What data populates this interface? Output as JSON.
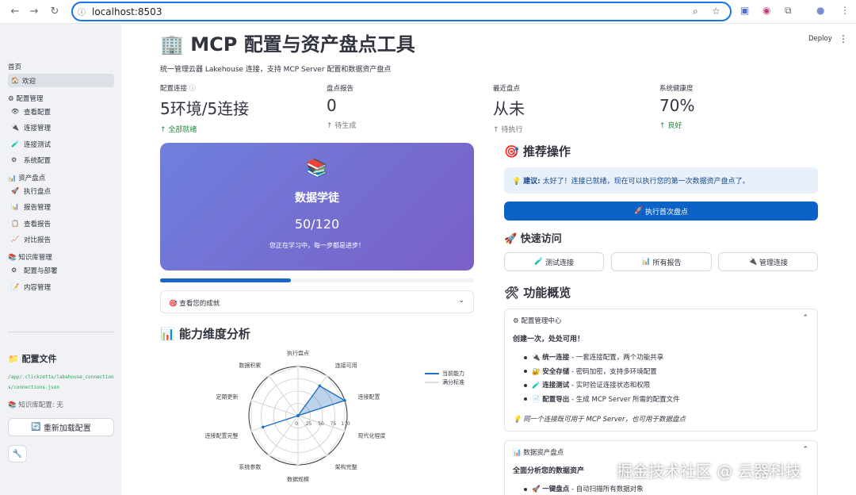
{
  "browser": {
    "url": "localhost:8503"
  },
  "sidebar": {
    "home_section": "首页",
    "welcome": "欢迎",
    "config_section": "配置管理",
    "config_items": [
      "查看配置",
      "连接管理",
      "连接测试",
      "系统配置"
    ],
    "assets_section": "资产盘点",
    "assets_items": [
      "执行盘点",
      "报告管理",
      "查看报告",
      "对比报告"
    ],
    "kb_section": "知识库管理",
    "kb_items": [
      "配置与部署",
      "内容管理"
    ],
    "config_file_title": "配置文件",
    "config_file_path": "/app/.clickzetta/lakehouse_connections/connections.json",
    "kb_config_status": "知识库配置: 无",
    "reload_button": "重新加载配置"
  },
  "header": {
    "deploy_label": "Deploy"
  },
  "main": {
    "title": "MCP 配置与资产盘点工具",
    "subtitle": "统一管理云器 Lakehouse 连接，支持 MCP Server 配置和数据资产盘点",
    "metrics": [
      {
        "label": "配置连接",
        "value": "5环境/5连接",
        "delta": "全部就绪",
        "trend": "up"
      },
      {
        "label": "盘点报告",
        "value": "0",
        "delta": "待生成",
        "trend": "neutral"
      },
      {
        "label": "最近盘点",
        "value": "从未",
        "delta": "待执行",
        "trend": "neutral"
      },
      {
        "label": "系统健康度",
        "value": "70%",
        "delta": "良好",
        "trend": "up"
      }
    ],
    "badge": {
      "title": "数据学徒",
      "value": "50/120",
      "message": "您正在学习中，每一步都是进步！"
    },
    "progress_fraction": 0.4167,
    "achievements_expander": "查看您的成就",
    "radar_title": "能力维度分析",
    "recommend_title": "推荐操作",
    "suggestion_label": "建议:",
    "suggestion_text": "太好了！连接已就绪，现在可以执行您的第一次数据资产盘点了。",
    "primary_button": "执行首次盘点",
    "quick_title": "快速访问",
    "quick_buttons": [
      "测试连接",
      "所有报告",
      "管理连接"
    ],
    "overview_title": "功能概览",
    "feature1": {
      "header": "配置管理中心",
      "lead": "创建一次，处处可用！",
      "items": [
        {
          "bold": "统一连接",
          "text": " - 一套连接配置，两个功能共享"
        },
        {
          "bold": "安全存储",
          "text": " - 密码加密，支持多环境配置"
        },
        {
          "bold": "连接测试",
          "text": " - 实时验证连接状态和权限"
        },
        {
          "bold": "配置导出",
          "text": " - 生成 MCP Server 所需的配置文件"
        }
      ],
      "note": "同一个连接既可用于 MCP Server，也可用于数据盘点"
    },
    "feature2": {
      "header": "数据资产盘点",
      "lead": "全面分析您的数据资产",
      "items": [
        {
          "bold": "一键盘点",
          "text": " - 自动扫描所有数据对象"
        }
      ]
    }
  },
  "chart_data": {
    "type": "radar",
    "categories": [
      "执行盘点",
      "连接可用",
      "连接配置",
      "现代化程度",
      "架构完整",
      "数据规模",
      "系统参数",
      "连接配置完整",
      "定期更新",
      "数据积累"
    ],
    "series": [
      {
        "name": "当前能力",
        "values": [
          0,
          75,
          100,
          0,
          0,
          0,
          0,
          75,
          0,
          0
        ],
        "color": "#1f6fc0"
      },
      {
        "name": "满分标准",
        "values": [
          100,
          100,
          100,
          100,
          100,
          100,
          100,
          100,
          100,
          100
        ],
        "color": "#dddddd"
      }
    ],
    "radial_ticks": [
      "0",
      "25",
      "50",
      "75",
      "100"
    ],
    "rlim": [
      0,
      100
    ],
    "legend": "top-right"
  },
  "watermark": "掘金技术社区 @ 云器科技",
  "colors": {
    "accent": "#0b63c7",
    "positive": "#1e8a3c",
    "badge_gradient_start": "#6f80dc",
    "badge_gradient_end": "#7a5fc8"
  }
}
